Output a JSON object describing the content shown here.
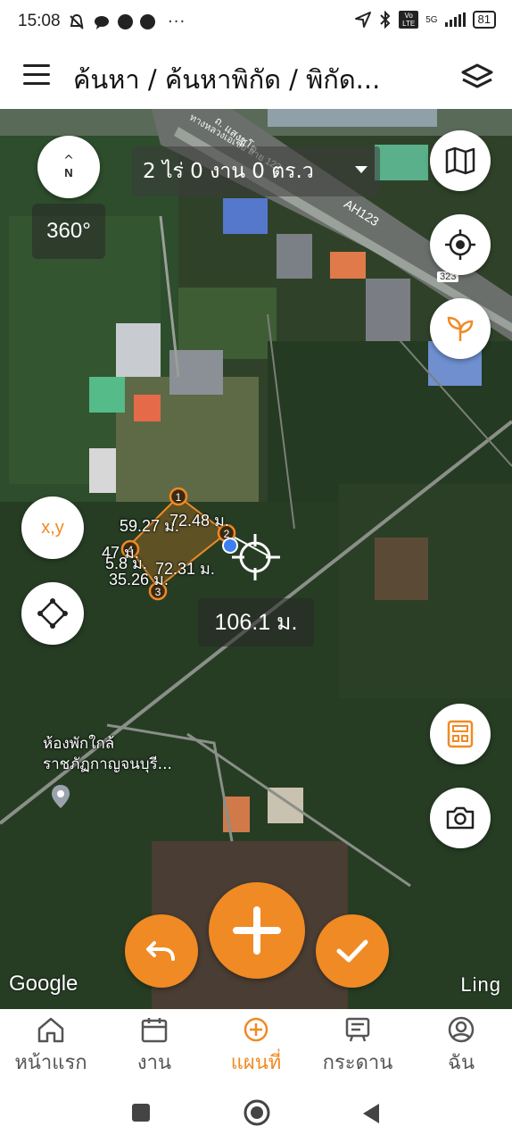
{
  "status_bar": {
    "time": "15:08",
    "network": "5G",
    "volte": "Vo LTE",
    "battery": "81"
  },
  "app_bar": {
    "title": "ค้นหา / ค้นหาพิกัด / พิกัด..."
  },
  "map": {
    "area_summary": "2 ไร่ 0 งาน 0 ตร.ว",
    "rotation": "360°",
    "compass_label": "N",
    "road_label": "AH123",
    "road_number": "323",
    "road_name": "ทางหลวงเอเชีย สาย 123",
    "soi_name": "ถ. แสงชูโต",
    "poi_label_line1": "ห้องพักใกล้",
    "poi_label_line2": "ราชภัฏกาญจนบุรี...",
    "xy_label": "x,y",
    "attribution": "Google",
    "watermark": "Ling",
    "total_distance": "106.1 ม.",
    "segment_labels": [
      "59.27 ม.",
      "72.48 ม.",
      "47 ม.",
      "5.8 ม.",
      "72.31 ม.",
      "35.26 ม."
    ],
    "points": [
      "1",
      "2",
      "3",
      "4"
    ]
  },
  "bottom_nav": {
    "items": [
      {
        "label": "หน้าแรก"
      },
      {
        "label": "งาน"
      },
      {
        "label": "แผนที่"
      },
      {
        "label": "กระดาน"
      },
      {
        "label": "ฉัน"
      }
    ],
    "active_index": 2,
    "accent_color": "#f08a24"
  }
}
